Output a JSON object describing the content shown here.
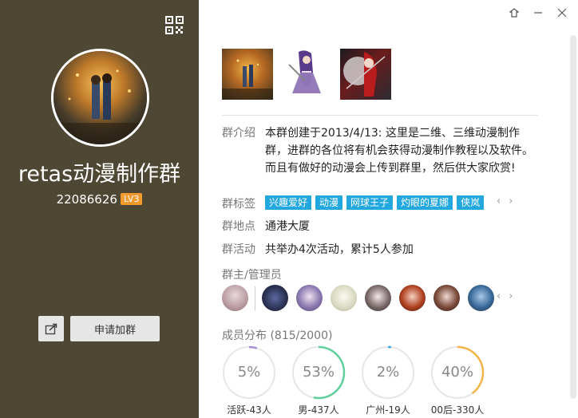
{
  "group": {
    "name": "retas动漫制作群",
    "id": "22086626",
    "level": "LV3"
  },
  "actions": {
    "join_label": "申请加群"
  },
  "window": {
    "skin_icon": "skin-icon",
    "min_icon": "minimize-icon",
    "close_icon": "close-icon"
  },
  "details": {
    "intro_label": "群介绍",
    "intro_text": "本群创建于2013/4/13: 这里是二维、三维动漫制作群，进群的各位将有机会获得动漫制作教程以及软件。而且有做好的动漫会上传到群里，然后供大家欣赏!",
    "tags_label": "群标签",
    "tags": [
      "兴趣爱好",
      "动漫",
      "网球王子",
      "灼眼的夏娜",
      "侠岚"
    ],
    "location_label": "群地点",
    "location": "通港大厦",
    "activity_label": "群活动",
    "activity": "共举办4次活动，累计5人参加"
  },
  "admins": {
    "title": "群主/管理员"
  },
  "members": {
    "title": "成员分布",
    "count": "(815/2000)",
    "stats": [
      {
        "value": "5%",
        "fraction": 0.05,
        "color": "#a58fd6",
        "label": "活跃-43人"
      },
      {
        "value": "53%",
        "fraction": 0.53,
        "color": "#5fcf9a",
        "label": "男-437人"
      },
      {
        "value": "2%",
        "fraction": 0.02,
        "color": "#4aa8e8",
        "label": "广州-19人"
      },
      {
        "value": "40%",
        "fraction": 0.4,
        "color": "#f5b447",
        "label": "00后-330人"
      }
    ]
  },
  "colors": {
    "sidebar_bg": "#4d4733",
    "tag_bg": "#22a7de",
    "badge_bg": "#f29a2e"
  }
}
